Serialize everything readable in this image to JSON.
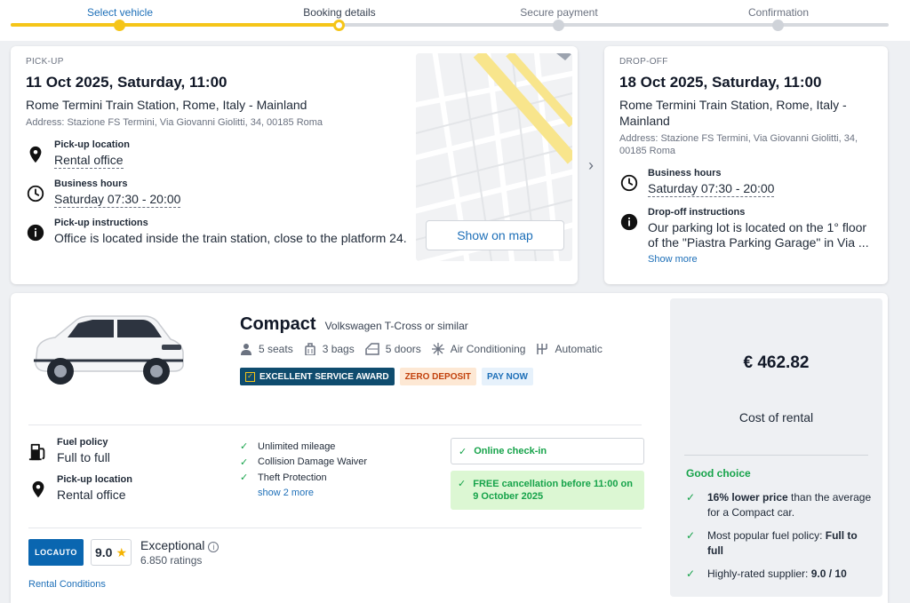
{
  "stepper": {
    "steps": [
      {
        "label": "Select vehicle"
      },
      {
        "label": "Booking details"
      },
      {
        "label": "Secure payment"
      },
      {
        "label": "Confirmation"
      }
    ]
  },
  "pickup": {
    "section_label": "PICK-UP",
    "datetime": "11 Oct 2025, Saturday, 11:00",
    "location": "Rome Termini Train Station, Rome, Italy - Mainland",
    "address": "Address: Stazione FS Termini, Via Giovanni Giolitti, 34, 00185 Roma",
    "location_type_label": "Pick-up location",
    "location_type_value": "Rental office",
    "hours_label": "Business hours",
    "hours_value": "Saturday 07:30 - 20:00",
    "instructions_label": "Pick-up instructions",
    "instructions_value": "Office is located inside the train station, close to the platform 24.",
    "map_button": "Show on map"
  },
  "dropoff": {
    "section_label": "DROP-OFF",
    "datetime": "18 Oct 2025, Saturday, 11:00",
    "location": "Rome Termini Train Station, Rome, Italy - Mainland",
    "address": "Address: Stazione FS Termini, Via Giovanni Giolitti, 34, 00185 Roma",
    "hours_label": "Business hours",
    "hours_value": "Saturday 07:30 - 20:00",
    "instructions_label": "Drop-off instructions",
    "instructions_value": "Our parking lot is located on the 1° floor of the \"Piastra Parking Garage\" in Via ...",
    "show_more": "Show more"
  },
  "offer": {
    "car_class": "Compact",
    "car_model": "Volkswagen T-Cross or similar",
    "specs": {
      "seats": "5 seats",
      "bags": "3 bags",
      "doors": "5 doors",
      "ac": "Air Conditioning",
      "transmission": "Automatic"
    },
    "badges": {
      "award": "EXCELLENT SERVICE AWARD",
      "zero_deposit": "ZERO DEPOSIT",
      "pay_now": "PAY NOW"
    },
    "fuel_policy_label": "Fuel policy",
    "fuel_policy_value": "Full to full",
    "pickup_location_label": "Pick-up location",
    "pickup_location_value": "Rental office",
    "inclusions": [
      "Unlimited mileage",
      "Collision Damage Waiver",
      "Theft Protection"
    ],
    "inclusions_more": "show 2 more",
    "online_checkin": "Online check-in",
    "free_cancellation": "FREE cancellation before 11:00 on 9 October 2025",
    "supplier_logo_text": "LOCAUTO",
    "score": "9.0",
    "rating_label": "Exceptional",
    "rating_count": "6.850 ratings",
    "rental_conditions": "Rental Conditions"
  },
  "price_panel": {
    "price": "€ 462.82",
    "price_label": "Cost of rental",
    "good_choice": "Good choice",
    "items": [
      {
        "bold": "16% lower price",
        "text": " than the average for a Compact car."
      },
      {
        "text": "Most popular fuel policy: ",
        "bold_after": "Full to full"
      },
      {
        "text": "Highly-rated supplier: ",
        "bold_after": "9.0 / 10"
      }
    ]
  },
  "colors": {
    "accent": "#f5c518",
    "link": "#1d6fb8",
    "success": "#16a34a",
    "award_bg": "#0f4c6e"
  }
}
